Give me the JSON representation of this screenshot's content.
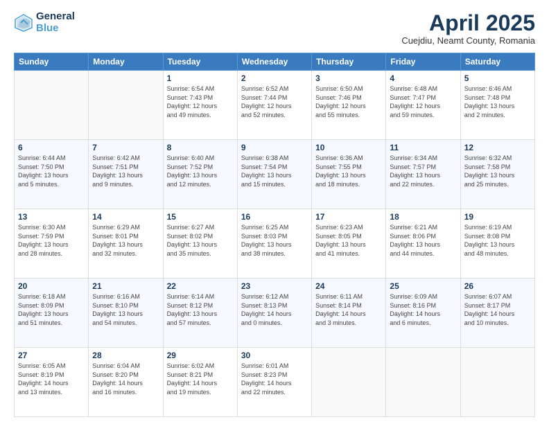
{
  "header": {
    "logo_line1": "General",
    "logo_line2": "Blue",
    "month_title": "April 2025",
    "subtitle": "Cuejdiu, Neamt County, Romania"
  },
  "days_of_week": [
    "Sunday",
    "Monday",
    "Tuesday",
    "Wednesday",
    "Thursday",
    "Friday",
    "Saturday"
  ],
  "weeks": [
    [
      {
        "day": "",
        "info": ""
      },
      {
        "day": "",
        "info": ""
      },
      {
        "day": "1",
        "info": "Sunrise: 6:54 AM\nSunset: 7:43 PM\nDaylight: 12 hours\nand 49 minutes."
      },
      {
        "day": "2",
        "info": "Sunrise: 6:52 AM\nSunset: 7:44 PM\nDaylight: 12 hours\nand 52 minutes."
      },
      {
        "day": "3",
        "info": "Sunrise: 6:50 AM\nSunset: 7:46 PM\nDaylight: 12 hours\nand 55 minutes."
      },
      {
        "day": "4",
        "info": "Sunrise: 6:48 AM\nSunset: 7:47 PM\nDaylight: 12 hours\nand 59 minutes."
      },
      {
        "day": "5",
        "info": "Sunrise: 6:46 AM\nSunset: 7:48 PM\nDaylight: 13 hours\nand 2 minutes."
      }
    ],
    [
      {
        "day": "6",
        "info": "Sunrise: 6:44 AM\nSunset: 7:50 PM\nDaylight: 13 hours\nand 5 minutes."
      },
      {
        "day": "7",
        "info": "Sunrise: 6:42 AM\nSunset: 7:51 PM\nDaylight: 13 hours\nand 9 minutes."
      },
      {
        "day": "8",
        "info": "Sunrise: 6:40 AM\nSunset: 7:52 PM\nDaylight: 13 hours\nand 12 minutes."
      },
      {
        "day": "9",
        "info": "Sunrise: 6:38 AM\nSunset: 7:54 PM\nDaylight: 13 hours\nand 15 minutes."
      },
      {
        "day": "10",
        "info": "Sunrise: 6:36 AM\nSunset: 7:55 PM\nDaylight: 13 hours\nand 18 minutes."
      },
      {
        "day": "11",
        "info": "Sunrise: 6:34 AM\nSunset: 7:57 PM\nDaylight: 13 hours\nand 22 minutes."
      },
      {
        "day": "12",
        "info": "Sunrise: 6:32 AM\nSunset: 7:58 PM\nDaylight: 13 hours\nand 25 minutes."
      }
    ],
    [
      {
        "day": "13",
        "info": "Sunrise: 6:30 AM\nSunset: 7:59 PM\nDaylight: 13 hours\nand 28 minutes."
      },
      {
        "day": "14",
        "info": "Sunrise: 6:29 AM\nSunset: 8:01 PM\nDaylight: 13 hours\nand 32 minutes."
      },
      {
        "day": "15",
        "info": "Sunrise: 6:27 AM\nSunset: 8:02 PM\nDaylight: 13 hours\nand 35 minutes."
      },
      {
        "day": "16",
        "info": "Sunrise: 6:25 AM\nSunset: 8:03 PM\nDaylight: 13 hours\nand 38 minutes."
      },
      {
        "day": "17",
        "info": "Sunrise: 6:23 AM\nSunset: 8:05 PM\nDaylight: 13 hours\nand 41 minutes."
      },
      {
        "day": "18",
        "info": "Sunrise: 6:21 AM\nSunset: 8:06 PM\nDaylight: 13 hours\nand 44 minutes."
      },
      {
        "day": "19",
        "info": "Sunrise: 6:19 AM\nSunset: 8:08 PM\nDaylight: 13 hours\nand 48 minutes."
      }
    ],
    [
      {
        "day": "20",
        "info": "Sunrise: 6:18 AM\nSunset: 8:09 PM\nDaylight: 13 hours\nand 51 minutes."
      },
      {
        "day": "21",
        "info": "Sunrise: 6:16 AM\nSunset: 8:10 PM\nDaylight: 13 hours\nand 54 minutes."
      },
      {
        "day": "22",
        "info": "Sunrise: 6:14 AM\nSunset: 8:12 PM\nDaylight: 13 hours\nand 57 minutes."
      },
      {
        "day": "23",
        "info": "Sunrise: 6:12 AM\nSunset: 8:13 PM\nDaylight: 14 hours\nand 0 minutes."
      },
      {
        "day": "24",
        "info": "Sunrise: 6:11 AM\nSunset: 8:14 PM\nDaylight: 14 hours\nand 3 minutes."
      },
      {
        "day": "25",
        "info": "Sunrise: 6:09 AM\nSunset: 8:16 PM\nDaylight: 14 hours\nand 6 minutes."
      },
      {
        "day": "26",
        "info": "Sunrise: 6:07 AM\nSunset: 8:17 PM\nDaylight: 14 hours\nand 10 minutes."
      }
    ],
    [
      {
        "day": "27",
        "info": "Sunrise: 6:05 AM\nSunset: 8:19 PM\nDaylight: 14 hours\nand 13 minutes."
      },
      {
        "day": "28",
        "info": "Sunrise: 6:04 AM\nSunset: 8:20 PM\nDaylight: 14 hours\nand 16 minutes."
      },
      {
        "day": "29",
        "info": "Sunrise: 6:02 AM\nSunset: 8:21 PM\nDaylight: 14 hours\nand 19 minutes."
      },
      {
        "day": "30",
        "info": "Sunrise: 6:01 AM\nSunset: 8:23 PM\nDaylight: 14 hours\nand 22 minutes."
      },
      {
        "day": "",
        "info": ""
      },
      {
        "day": "",
        "info": ""
      },
      {
        "day": "",
        "info": ""
      }
    ]
  ]
}
